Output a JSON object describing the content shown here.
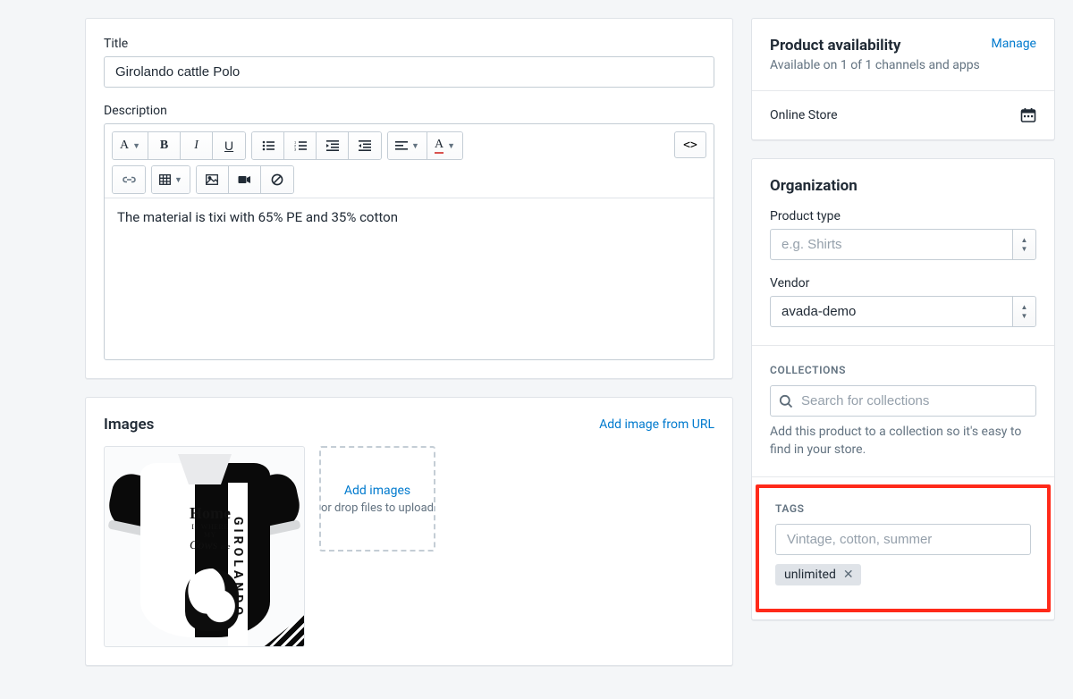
{
  "title_section": {
    "label": "Title",
    "value": "Girolando cattle Polo"
  },
  "description": {
    "label": "Description",
    "body": "The material is tixi with 65% PE and 35% cotton",
    "code_button": "<>"
  },
  "images": {
    "heading": "Images",
    "add_from_url": "Add image from URL",
    "dropzone_link": "Add images",
    "dropzone_sub": "or drop files to upload",
    "polo_stripe": "GIROLANDO",
    "polo_home": "Home",
    "polo_where": "IS WHERE MY",
    "polo_cows": "Cows",
    "polo_are": "are"
  },
  "availability": {
    "heading": "Product availability",
    "manage": "Manage",
    "sub": "Available on 1 of 1 channels and apps",
    "channel": "Online Store"
  },
  "organization": {
    "heading": "Organization",
    "product_type_label": "Product type",
    "product_type_placeholder": "e.g. Shirts",
    "vendor_label": "Vendor",
    "vendor_value": "avada-demo"
  },
  "collections": {
    "heading": "COLLECTIONS",
    "placeholder": "Search for collections",
    "hint": "Add this product to a collection so it's easy to find in your store."
  },
  "tags": {
    "heading": "TAGS",
    "placeholder": "Vintage, cotton, summer",
    "chips": [
      "unlimited"
    ]
  }
}
